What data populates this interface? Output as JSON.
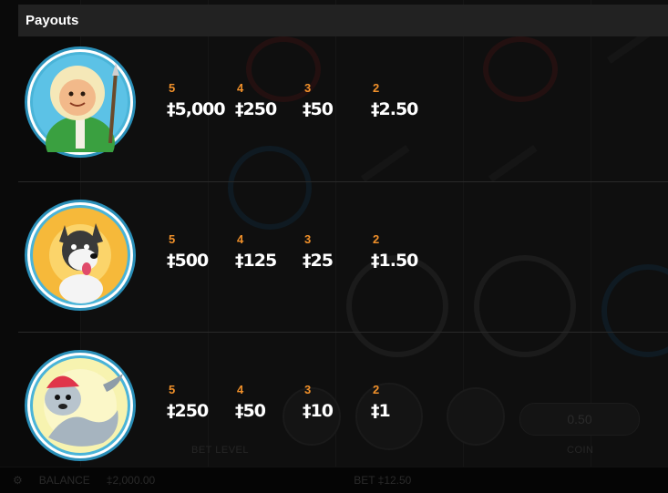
{
  "panel": {
    "title": "Payouts"
  },
  "paytable": [
    {
      "symbol_icon": "eskimo-boy-icon",
      "payouts": [
        {
          "count": "5",
          "amount": "‡5,000"
        },
        {
          "count": "4",
          "amount": "‡250"
        },
        {
          "count": "3",
          "amount": "‡50"
        },
        {
          "count": "2",
          "amount": "‡2.50"
        }
      ]
    },
    {
      "symbol_icon": "husky-dog-icon",
      "payouts": [
        {
          "count": "5",
          "amount": "‡500"
        },
        {
          "count": "4",
          "amount": "‡125"
        },
        {
          "count": "3",
          "amount": "‡25"
        },
        {
          "count": "2",
          "amount": "‡1.50"
        }
      ]
    },
    {
      "symbol_icon": "seal-icon",
      "payouts": [
        {
          "count": "5",
          "amount": "‡250"
        },
        {
          "count": "4",
          "amount": "‡50"
        },
        {
          "count": "3",
          "amount": "‡10"
        },
        {
          "count": "2",
          "amount": "‡1"
        }
      ]
    }
  ],
  "background": {
    "bet_level_label": "BET LEVEL",
    "coin_label": "COIN",
    "coin_value": "0.50",
    "balance_label": "BALANCE",
    "balance_value": "‡2,000.00",
    "bet_label": "BET ‡12.50"
  },
  "colors": {
    "count_color": "#f0902a",
    "amount_color": "#ffffff",
    "header_bg": "#222222",
    "portrait_ring": "#2a8fb8"
  }
}
